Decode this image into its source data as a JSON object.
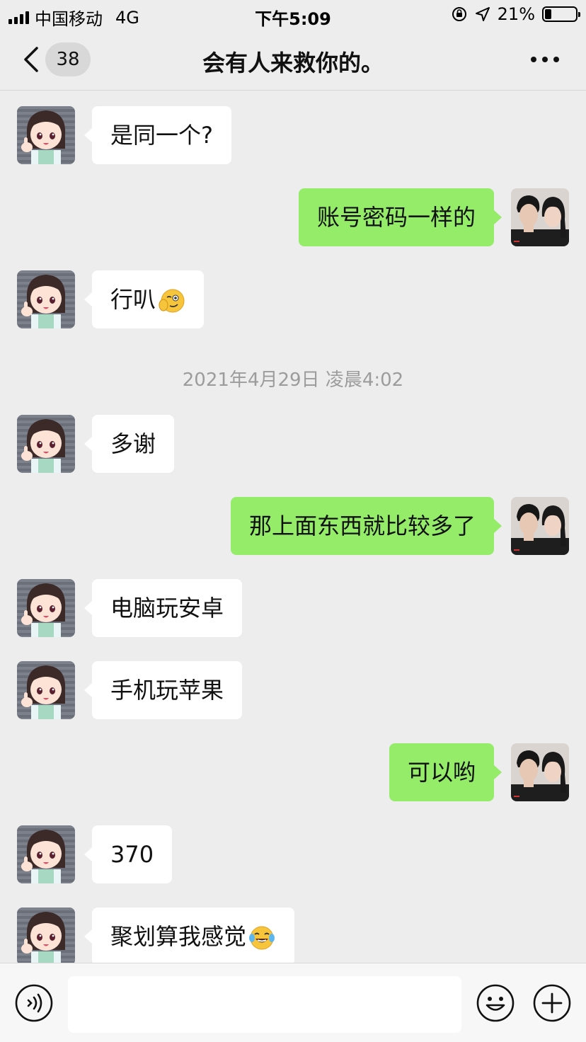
{
  "status_bar": {
    "carrier": "中国移动",
    "network": "4G",
    "time": "下午5:09",
    "battery_percent": "21%",
    "battery_level": 0.21
  },
  "nav": {
    "unread_count": "38",
    "title": "会有人来救你的。"
  },
  "messages": [
    {
      "side": "in",
      "text": "是同一个?"
    },
    {
      "side": "out",
      "text": "账号密码一样的"
    },
    {
      "side": "in",
      "text": "行叭",
      "emoji": "smirk-face-emoji"
    },
    {
      "timestamp": "2021年4月29日 凌晨4:02"
    },
    {
      "side": "in",
      "text": "多谢"
    },
    {
      "side": "out",
      "text": "那上面东西就比较多了"
    },
    {
      "side": "in",
      "text": "电脑玩安卓"
    },
    {
      "side": "in",
      "text": "手机玩苹果"
    },
    {
      "side": "out",
      "text": "可以哟"
    },
    {
      "side": "in",
      "text": "370"
    },
    {
      "side": "in",
      "text": "聚划算我感觉",
      "emoji": "tears-of-joy-emoji"
    }
  ],
  "input": {
    "placeholder": ""
  },
  "colors": {
    "background": "#ededed",
    "incoming_bubble": "#ffffff",
    "outgoing_bubble": "#95ec69",
    "timestamp_text": "#9c9c9c"
  },
  "icons": {
    "back": "chevron-left-icon",
    "more": "ellipsis-icon",
    "voice": "voice-icon",
    "emoji": "emoji-icon",
    "plus": "plus-circle-icon"
  }
}
